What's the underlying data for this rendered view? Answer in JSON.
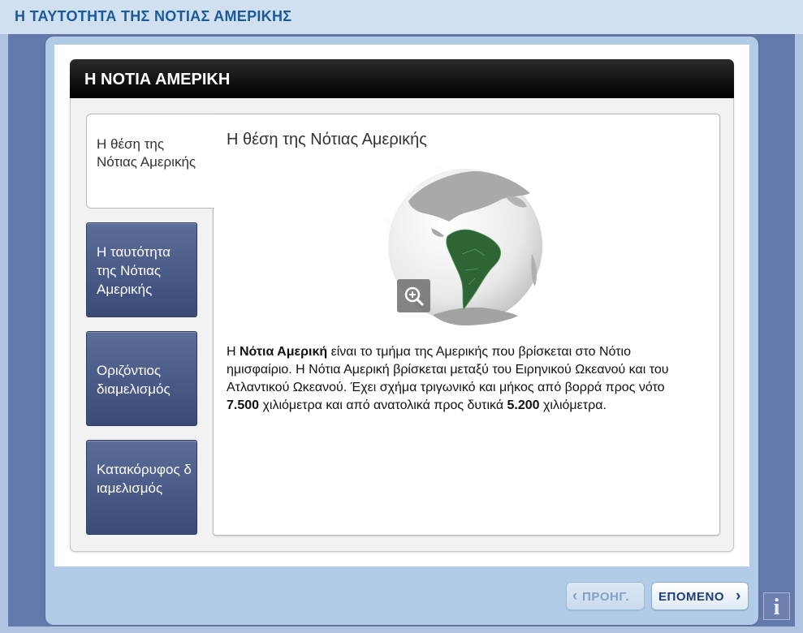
{
  "app": {
    "title": "Η ΤΑΥΤΟΤΗΤΑ ΤΗΣ ΝΟΤΙΑΣ ΑΜΕΡΙΚΗΣ"
  },
  "card": {
    "title": "Η ΝΟΤΙΑ ΑΜΕΡΙΚΗ"
  },
  "tabs": [
    {
      "label": "Η θέση της Νότιας Αμερικής",
      "active": true
    },
    {
      "label": "Η ταυτότητα της Νότιας Αμερικής",
      "active": false
    },
    {
      "label": "Οριζόντιος διαμελισμός",
      "active": false
    },
    {
      "label": "Κατακόρυφος διαμελισμός",
      "active": false
    }
  ],
  "content": {
    "title": "Η θέση της Νότιας Αμερικής",
    "image": {
      "icon": "globe-south-america-icon",
      "zoom_icon": "zoom-in-icon"
    },
    "text": {
      "p1": "Η ",
      "b1": "Νότια Αμερική",
      "p2": " είναι το τμήμα της Αμερικής που βρίσκεται στο Νότιο ημισφαίριο. Η Νότια Αμερική βρίσκεται μεταξύ του Ειρηνικού Ωκεανού και του Ατλαντικού Ωκεανού. Έχει σχήμα τριγωνικό και μήκος από βορρά προς νότο ",
      "b2": "7.500",
      "p3": " χιλιόμετρα και από ανατολικά προς δυτικά ",
      "b3": "5.200",
      "p4": " χιλιόμετρα."
    }
  },
  "nav": {
    "prev_label": "ΠΡΟΗΓ.",
    "next_label": "ΕΠΟΜΕΝΟ",
    "prev_arrow": "‹",
    "next_arrow": "›",
    "info_glyph": "i"
  },
  "colors": {
    "header_text": "#1b5a98",
    "land": "#2e6535",
    "tab_bg": "#4b5b87",
    "frame": "#b2cbe6"
  }
}
